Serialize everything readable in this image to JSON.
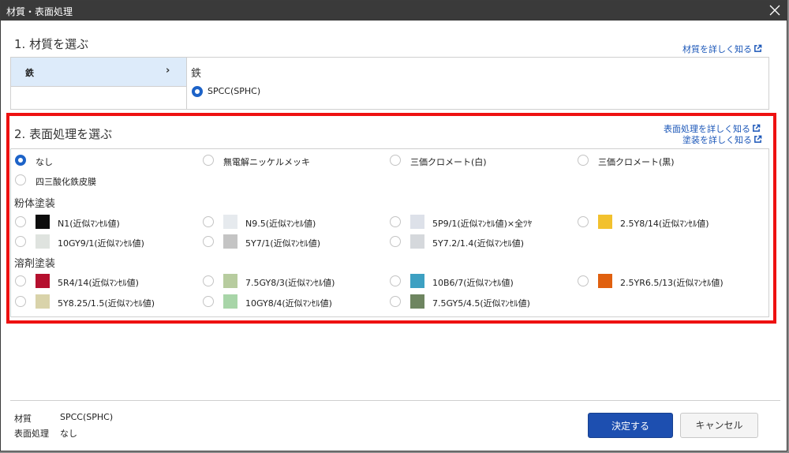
{
  "dialog": {
    "title": "材質・表面処理",
    "close_icon": "close-icon"
  },
  "material": {
    "heading": "1. 材質を選ぶ",
    "detail_link": "材質を詳しく知る",
    "categories": [
      {
        "label": "鉄",
        "selected": true
      }
    ],
    "selected_category_title": "鉄",
    "options": [
      {
        "label": "SPCC(SPHC)",
        "selected": true
      }
    ]
  },
  "surface": {
    "heading": "2. 表面処理を選ぶ",
    "detail_link": "表面処理を詳しく知る",
    "paint_link": "塗装を詳しく知る",
    "basic": [
      {
        "label": "なし",
        "selected": true
      },
      {
        "label": "無電解ニッケルメッキ",
        "selected": false
      },
      {
        "label": "三価クロメート(白)",
        "selected": false
      },
      {
        "label": "三価クロメート(黒)",
        "selected": false
      },
      {
        "label": "四三酸化鉄皮膜",
        "selected": false
      }
    ],
    "powder_title": "粉体塗装",
    "powder": [
      {
        "label": "N1(近似ﾏﾝｾﾙ値)",
        "color": "#0d0d0d"
      },
      {
        "label": "N9.5(近似ﾏﾝｾﾙ値)",
        "color": "#e6eaee"
      },
      {
        "label": "5P9/1(近似ﾏﾝｾﾙ値)×全ﾂﾔ",
        "color": "#dde1e9"
      },
      {
        "label": "2.5Y8/14(近似ﾏﾝｾﾙ値)",
        "color": "#f2c12e"
      },
      {
        "label": "10GY9/1(近似ﾏﾝｾﾙ値)",
        "color": "#dfe3df"
      },
      {
        "label": "5Y7/1(近似ﾏﾝｾﾙ値)",
        "color": "#c4c4c4"
      },
      {
        "label": "5Y7.2/1.4(近似ﾏﾝｾﾙ値)",
        "color": "#d5d8dc"
      }
    ],
    "solvent_title": "溶剤塗装",
    "solvent": [
      {
        "label": "5R4/14(近似ﾏﾝｾﾙ値)",
        "color": "#b5102e"
      },
      {
        "label": "7.5GY8/3(近似ﾏﾝｾﾙ値)",
        "color": "#b7cc9f"
      },
      {
        "label": "10B6/7(近似ﾏﾝｾﾙ値)",
        "color": "#3da0c2"
      },
      {
        "label": "2.5YR6.5/13(近似ﾏﾝｾﾙ値)",
        "color": "#e0600f"
      },
      {
        "label": "5Y8.25/1.5(近似ﾏﾝｾﾙ値)",
        "color": "#d9d3aa"
      },
      {
        "label": "10GY8/4(近似ﾏﾝｾﾙ値)",
        "color": "#a8d5a8"
      },
      {
        "label": "7.5GY5/4.5(近似ﾏﾝｾﾙ値)",
        "color": "#6e8560"
      }
    ]
  },
  "summary": {
    "material_label": "材質",
    "material_value": "SPCC(SPHC)",
    "surface_label": "表面処理",
    "surface_value": "なし"
  },
  "actions": {
    "confirm_label": "決定する",
    "cancel_label": "キャンセル"
  },
  "colors": {
    "accent": "#1d63c8",
    "primary_button": "#1d4fb0",
    "highlight_border": "#ee1111",
    "selected_category_bg": "#ddebfa"
  }
}
